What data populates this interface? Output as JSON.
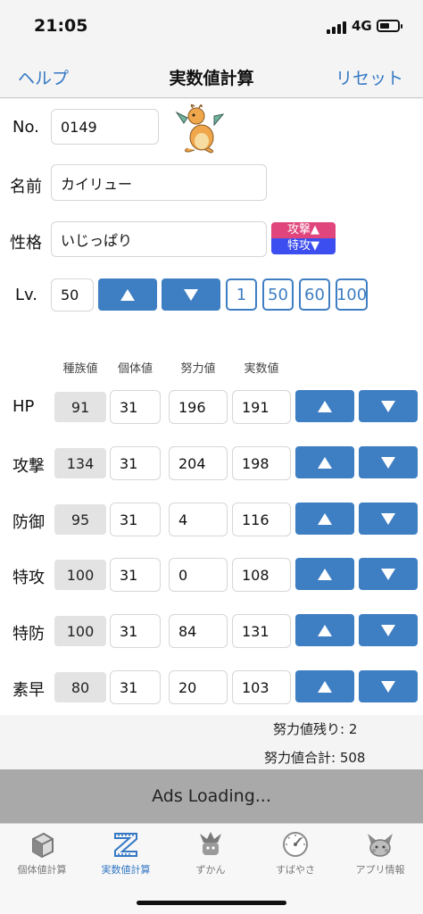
{
  "status": {
    "time": "21:05",
    "network": "4G"
  },
  "nav": {
    "left": "ヘルプ",
    "title": "実数値計算",
    "right": "リセット"
  },
  "form": {
    "no_label": "No.",
    "no_value": "0149",
    "name_label": "名前",
    "name_value": "カイリュー",
    "nature_label": "性格",
    "nature_value": "いじっぱり",
    "nature_up": "攻撃▲",
    "nature_down": "特攻▼",
    "lv_label": "Lv.",
    "lv_value": "50",
    "lv_presets": [
      "1",
      "50",
      "60",
      "100"
    ]
  },
  "columns": {
    "base": "種族値",
    "iv": "個体値",
    "ev": "努力値",
    "actual": "実数値"
  },
  "stats": [
    {
      "label": "HP",
      "base": "91",
      "iv": "31",
      "ev": "196",
      "actual": "191"
    },
    {
      "label": "攻撃",
      "base": "134",
      "iv": "31",
      "ev": "204",
      "actual": "198"
    },
    {
      "label": "防御",
      "base": "95",
      "iv": "31",
      "ev": "4",
      "actual": "116"
    },
    {
      "label": "特攻",
      "base": "100",
      "iv": "31",
      "ev": "0",
      "actual": "108"
    },
    {
      "label": "特防",
      "base": "100",
      "iv": "31",
      "ev": "84",
      "actual": "131"
    },
    {
      "label": "素早",
      "base": "80",
      "iv": "31",
      "ev": "20",
      "actual": "103"
    }
  ],
  "summary": {
    "remaining": "努力値残り: 2",
    "total": "努力値合計: 508"
  },
  "ads": "Ads Loading...",
  "tabs": [
    {
      "label": "個体値計算",
      "icon": "cube-icon"
    },
    {
      "label": "実数値計算",
      "icon": "ruler-icon"
    },
    {
      "label": "ずかん",
      "icon": "pokedex-icon"
    },
    {
      "label": "すばやさ",
      "icon": "speedometer-icon"
    },
    {
      "label": "アプリ情報",
      "icon": "creature-icon"
    }
  ],
  "colors": {
    "accent": "#3e7ec2",
    "link": "#3478c4",
    "nature_up": "#e0457b",
    "nature_down": "#3d4ef0"
  }
}
